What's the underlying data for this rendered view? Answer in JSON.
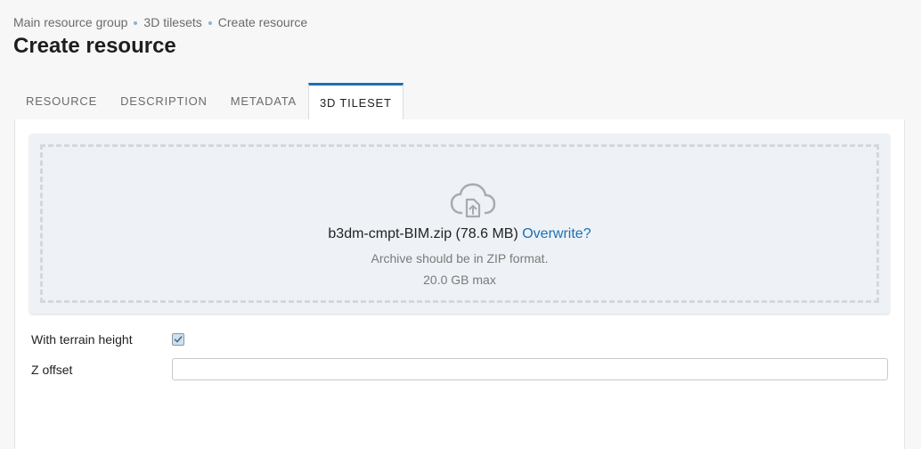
{
  "breadcrumb": {
    "items": [
      "Main resource group",
      "3D tilesets",
      "Create resource"
    ]
  },
  "page_title": "Create resource",
  "tabs": [
    {
      "label": "RESOURCE",
      "active": false
    },
    {
      "label": "DESCRIPTION",
      "active": false
    },
    {
      "label": "METADATA",
      "active": false
    },
    {
      "label": "3D TILESET",
      "active": true
    }
  ],
  "upload": {
    "icon": "cloud-upload-icon",
    "file_name": "b3dm-cmpt-BIM.zip (78.6 MB)",
    "overwrite_label": "Overwrite?",
    "hint_format": "Archive should be in ZIP format.",
    "hint_max": "20.0 GB max"
  },
  "form": {
    "terrain_label": "With terrain height",
    "terrain_checked": true,
    "z_offset_label": "Z offset",
    "z_offset_value": ""
  },
  "colors": {
    "accent": "#1d6fb5",
    "dropzone_bg": "#eef2f6"
  }
}
